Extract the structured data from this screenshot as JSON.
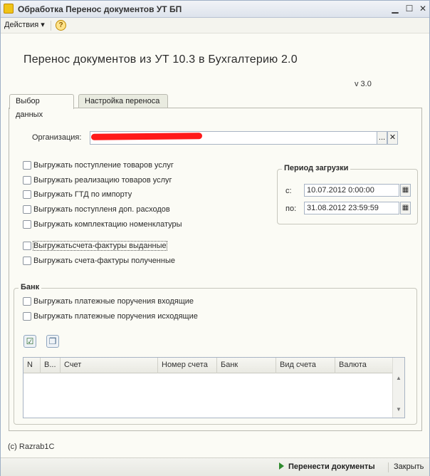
{
  "window": {
    "title": "Обработка  Перенос документов УТ БП",
    "minimize_glyph": "▁",
    "maximize_glyph": "☐",
    "close_glyph": "✕"
  },
  "toolbar": {
    "actions_label": "Действия ▾",
    "help_glyph": "?"
  },
  "header": {
    "title": "Перенос документов из УТ 10.3  в Бухгалтерию 2.0",
    "version": "v 3.0"
  },
  "tabs": [
    {
      "label": "Выбор данных",
      "active": true
    },
    {
      "label": "Настройка переноса",
      "active": false
    }
  ],
  "organization": {
    "label": "Организация:",
    "value": "",
    "select_glyph": "...",
    "clear_glyph": "✕",
    "redaction_color": "#ff1a1a"
  },
  "checkboxes": [
    {
      "label": "Выгружать поступление товаров услуг",
      "checked": false
    },
    {
      "label": "Выгружать реализацию товаров услуг",
      "checked": false
    },
    {
      "label": "Выгружать ГТД по импорту",
      "checked": false
    },
    {
      "label": "Выгружать поступленя доп. расходов",
      "checked": false
    },
    {
      "label": "Выгружать комплектацию номенклатуры",
      "checked": false
    },
    {
      "label": "Выгружатьсчета-фактуры выданные",
      "checked": false
    },
    {
      "label": "Выгружать счета-фактуры полученные",
      "checked": false
    }
  ],
  "period": {
    "title": "Период загрузки",
    "from_label": "с:",
    "from_value": "10.07.2012  0:00:00",
    "to_label": "по:",
    "to_value": "31.08.2012 23:59:59",
    "calendar_glyph": "▦"
  },
  "bank": {
    "title": "Банк",
    "checkboxes": [
      {
        "label": "Выгружать платежные поручения входящие",
        "checked": false
      },
      {
        "label": "Выгружать платежные поручения исходящие",
        "checked": false
      }
    ],
    "check_all_icon": "check-all-icon",
    "uncheck_all_icon": "uncheck-all-icon",
    "table_columns": [
      "N",
      "В...",
      "Счет",
      "Номер счета",
      "Банк",
      "Вид счета",
      "Валюта"
    ]
  },
  "footer": {
    "copyright": "(c) Razrab1C",
    "transfer_label": "Перенести документы",
    "close_label": "Закрыть",
    "accent_color": "#2d8a2d"
  }
}
